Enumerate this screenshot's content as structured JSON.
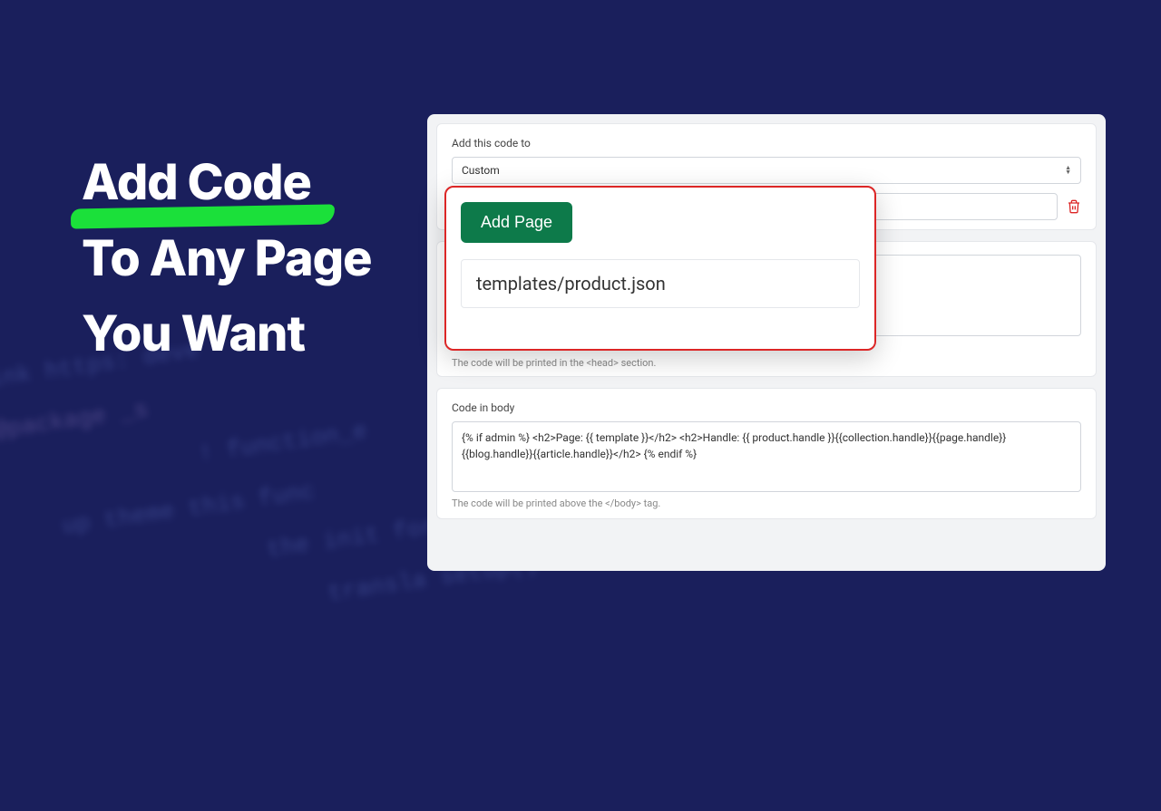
{
  "headline": {
    "line1": "Add Code",
    "line2": "To Any Page",
    "line3": "You Want"
  },
  "panel": {
    "section1": {
      "label": "Add this code to",
      "select_value": "Custom"
    },
    "section2": {
      "hint": "The code will be printed in the <head> section."
    },
    "section3": {
      "label": "Code in body",
      "code": "{% if admin %} <h2>Page: {{ template }}</h2> <h2>Handle: {{ product.handle }}{{collection.handle}}{{page.handle}}{{blog.handle}}{{article.handle}}</h2> {% endif %}",
      "hint": "The code will be printed above the </body> tag."
    }
  },
  "popout": {
    "button": "Add Page",
    "item": "templates/product.json"
  },
  "bg_code": {
    "l1": "* @link  https: deve",
    "l2": "@package  _s",
    "l3": "!  function_e",
    "l4": "up theme   this func",
    "l5": "the init for",
    "l6": "transla     setup()"
  }
}
